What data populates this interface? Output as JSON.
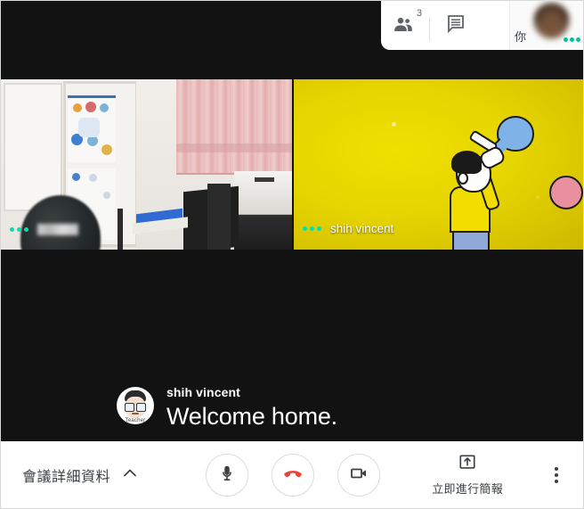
{
  "app": {
    "name": "google-meet",
    "accent_green": "#00c39a",
    "hangup_red": "#ea4335",
    "toolbar_bg": "#ffffff",
    "stage_bg": "#121212"
  },
  "header": {
    "participants": {
      "icon": "people-icon",
      "count": "3"
    },
    "chat": {
      "icon": "chat-icon"
    },
    "self_view": {
      "label": "你",
      "avatar": "self-avatar-blurred",
      "audio_indicator": "active"
    }
  },
  "tiles": [
    {
      "id": "tile-left",
      "name": "",
      "name_redacted": true,
      "audio_indicator": "active",
      "scene": "classroom-room-with-cabinet-curtain-printer"
    },
    {
      "id": "tile-right",
      "name": "shih vincent",
      "name_redacted": false,
      "audio_indicator": "active",
      "scene": "yellow-cartoon-person-blowing-balloon"
    }
  ],
  "caption": {
    "speaker": "shih vincent",
    "text": "Welcome home.",
    "avatar_badge": "Teacher"
  },
  "toolbar": {
    "meeting_details_label": "會議詳細資料",
    "meeting_details_chevron": "chevron-up-icon",
    "mic_button": {
      "icon": "microphone-icon",
      "state": "on"
    },
    "hangup_button": {
      "icon": "phone-hangup-icon"
    },
    "camera_button": {
      "icon": "video-camera-icon",
      "state": "on"
    },
    "present_label": "立即進行簡報",
    "present_icon": "present-upload-icon",
    "more_options_icon": "more-vertical-icon"
  }
}
